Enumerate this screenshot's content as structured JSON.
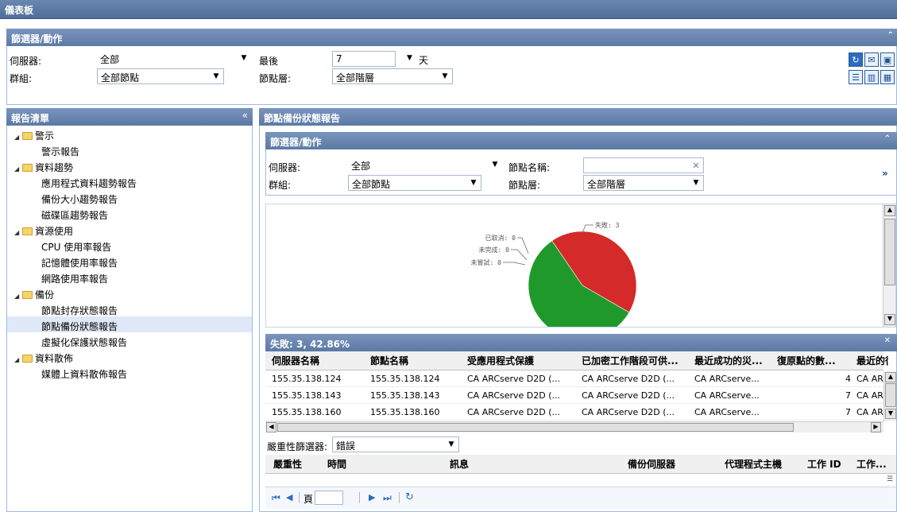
{
  "app_title": "儀表板",
  "top_filter": {
    "title": "篩選器/動作",
    "server_label": "伺服器:",
    "server_value": "全部",
    "group_label": "群組:",
    "group_value": "全部節點",
    "last_label": "最後",
    "last_value": "7",
    "last_unit": "天",
    "node_tier_label": "節點層:",
    "node_tier_value": "全部階層"
  },
  "report_list": {
    "title": "報告清單",
    "collapse": "«",
    "groups": [
      {
        "label": "警示",
        "items": [
          "警示報告"
        ]
      },
      {
        "label": "資料趨勢",
        "items": [
          "應用程式資料趨勢報告",
          "備份大小趨勢報告",
          "磁碟區趨勢報告"
        ]
      },
      {
        "label": "資源使用",
        "items": [
          "CPU 使用率報告",
          "記憶體使用率報告",
          "網路使用率報告"
        ]
      },
      {
        "label": "備份",
        "items": [
          "節點封存狀態報告",
          "節點備份狀態報告",
          "虛擬化保護狀態報告"
        ]
      },
      {
        "label": "資料散佈",
        "items": [
          "媒體上資料散佈報告"
        ]
      }
    ]
  },
  "report": {
    "title": "節點備份狀態報告",
    "filter": {
      "title": "篩選器/動作",
      "server_label": "伺服器:",
      "server_value": "全部",
      "group_label": "群組:",
      "group_value": "全部節點",
      "node_name_label": "節點名稱:",
      "node_name_value": "",
      "node_tier_label": "節點層:",
      "node_tier_value": "全部階層",
      "expand": "»"
    },
    "chart_labels": {
      "failed": "失敗: 3",
      "cancelled": "已取消: 0",
      "incomplete": "未完成: 0",
      "not_attempted": "未嘗試: 0"
    },
    "detail_title": "失敗: 3, 42.86%",
    "table": {
      "columns": [
        "伺服器名稱",
        "節點名稱",
        "受應用程式保護",
        "已加密工作階段可供...",
        "最近成功的災...",
        "復原點的數...",
        "最近的復"
      ],
      "rows": [
        [
          "155.35.138.124",
          "155.35.138.124",
          "CA ARCserve D2D (...",
          "CA ARCserve D2D (...",
          "CA ARCserve...",
          "4",
          "CA AR"
        ],
        [
          "155.35.138.143",
          "155.35.138.143",
          "CA ARCserve D2D (...",
          "CA ARCserve D2D (...",
          "CA ARCserve...",
          "7",
          "CA AR"
        ],
        [
          "155.35.138.160",
          "155.35.138.160",
          "CA ARCserve D2D (...",
          "CA ARCserve D2D (...",
          "CA ARCserve...",
          "7",
          "CA AR"
        ]
      ]
    },
    "severity_label": "嚴重性篩選器:",
    "severity_value": "錯誤",
    "log_columns": [
      "嚴重性",
      "時間",
      "訊息",
      "備份伺服器",
      "代理程式主機",
      "工作 ID",
      "工作..."
    ],
    "pager": {
      "page_label": "頁",
      "page_value": ""
    }
  },
  "chart_data": {
    "type": "pie",
    "title": "",
    "slices": [
      {
        "name": "失敗",
        "value": 3,
        "color": "#d42a2a"
      },
      {
        "name": "已取消",
        "value": 0
      },
      {
        "name": "未完成",
        "value": 0
      },
      {
        "name": "未嘗試",
        "value": 0
      },
      {
        "name": "",
        "value": 4,
        "color": "#1f9a2a"
      }
    ]
  },
  "colors": {
    "header": "#5b79a4",
    "selected_row": "#dfe8f6",
    "failed": "#d42a2a",
    "success": "#1f9a2a"
  }
}
